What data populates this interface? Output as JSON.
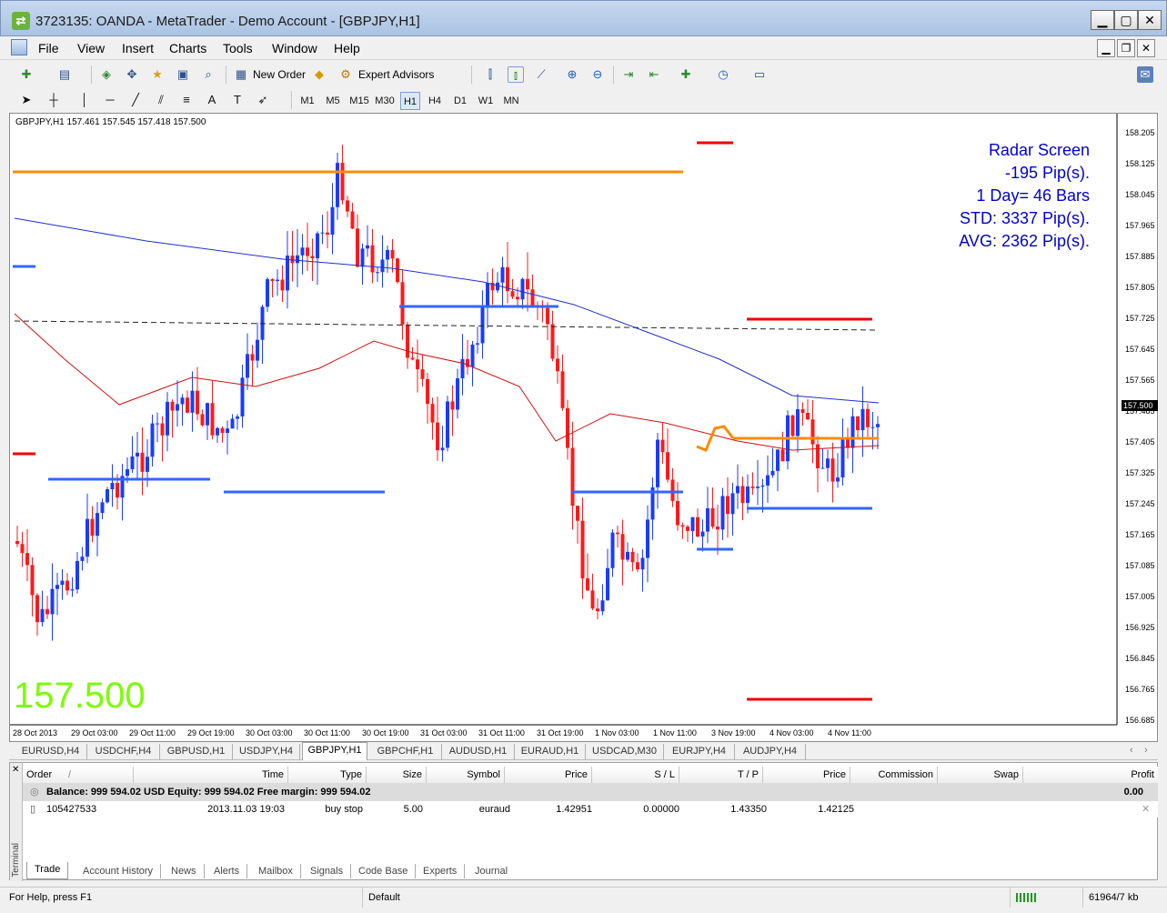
{
  "window": {
    "title": "3723135: OANDA - MetaTrader - Demo Account - [GBPJPY,H1]",
    "controls": [
      "▁",
      "▢",
      "✕"
    ],
    "mdi_controls": [
      "▁",
      "❐",
      "✕"
    ]
  },
  "menu": [
    "File",
    "View",
    "Insert",
    "Charts",
    "Tools",
    "Window",
    "Help"
  ],
  "toolbar": {
    "new_order": "New Order",
    "expert_advisors": "Expert Advisors"
  },
  "timeframes": [
    "M1",
    "M5",
    "M15",
    "M30",
    "H1",
    "H4",
    "D1",
    "W1",
    "MN"
  ],
  "chart": {
    "header": "GBPJPY,H1  157.461 157.545 157.418 157.500",
    "big_price": "157.500",
    "price_tag": "157.500",
    "radar": [
      "Radar Screen",
      "-195 Pip(s).",
      "1 Day= 46 Bars",
      "STD: 3337 Pip(s).",
      "AVG: 2362 Pip(s)."
    ],
    "y_ticks": [
      "158.205",
      "158.125",
      "158.045",
      "157.965",
      "157.885",
      "157.805",
      "157.725",
      "157.645",
      "157.565",
      "157.485",
      "157.405",
      "157.325",
      "157.245",
      "157.165",
      "157.085",
      "157.005",
      "156.925",
      "156.845",
      "156.765",
      "156.685"
    ],
    "x_ticks": [
      "28 Oct 2013",
      "29 Oct 03:00",
      "29 Oct 11:00",
      "29 Oct 19:00",
      "30 Oct 03:00",
      "30 Oct 11:00",
      "30 Oct 19:00",
      "31 Oct 03:00",
      "31 Oct 11:00",
      "31 Oct 19:00",
      "1 Nov 03:00",
      "1 Nov 11:00",
      "3 Nov 19:00",
      "4 Nov 03:00",
      "4 Nov 11:00"
    ],
    "colors": {
      "bull": "#1a3cff",
      "bear": "#ff1a1a",
      "ma_blue": "#1e2fd0",
      "ma_red": "#d01010",
      "level_orange": "#ff8c00",
      "level_blue": "#3366ff",
      "level_red": "#ee0000"
    }
  },
  "symbol_tabs": [
    "EURUSD,H4",
    "USDCHF,H4",
    "GBPUSD,H1",
    "USDJPY,H4",
    "GBPJPY,H1",
    "GBPCHF,H1",
    "AUDUSD,H1",
    "EURAUD,H1",
    "USDCAD,M30",
    "EURJPY,H4",
    "AUDJPY,H4"
  ],
  "active_symbol_tab": "GBPJPY,H1",
  "terminal": {
    "side_label": "Terminal",
    "columns": [
      "Order",
      "/",
      "Time",
      "Type",
      "Size",
      "Symbol",
      "Price",
      "S / L",
      "T / P",
      "Price",
      "Commission",
      "Swap",
      "Profit"
    ],
    "balance_line": "Balance: 999 594.02 USD  Equity: 999 594.02  Free margin: 999 594.02",
    "balance_profit": "0.00",
    "order": {
      "id": "105427533",
      "time": "2013.11.03 19:03",
      "type": "buy stop",
      "size": "5.00",
      "symbol": "euraud",
      "price": "1.42951",
      "sl": "0.00000",
      "tp": "1.43350",
      "cur_price": "1.42125"
    },
    "tabs": [
      "Trade",
      "Account History",
      "News",
      "Alerts",
      "Mailbox",
      "Signals",
      "Code Base",
      "Experts",
      "Journal"
    ]
  },
  "status": {
    "help": "For Help, press F1",
    "profile": "Default",
    "traffic": "61964/7 kb"
  }
}
